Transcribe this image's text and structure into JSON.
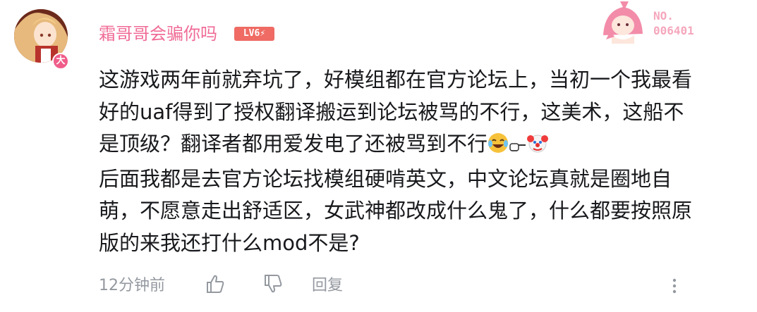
{
  "user": {
    "name": "霜哥哥会骗你吗",
    "level": "LV6",
    "avatar_badge": "大"
  },
  "decoration": {
    "number_label": "NO.",
    "number_value": "006401"
  },
  "comment": {
    "text": "这游戏两年前就弃坑了，好模组都在官方论坛上，当初一个我最看\n好的uaf得到了授权翻译搬运到论坛被骂的不行，这美术，这船不\n是顶级？翻译者都用爱发电了还被骂到不行",
    "text2": "后面我都是去官方论坛找模组硬啃英文，中文论坛真就是圈地自\n萌，不愿意走出舒适区，女武神都改成什么鬼了，什么都要按照原\n版的来我还打什么mod不是?"
  },
  "footer": {
    "time": "12分钟前",
    "reply_label": "回复"
  },
  "colors": {
    "username": "#f06b96",
    "level_badge": "#ef6b64",
    "text": "#18191c",
    "meta": "#9499a0"
  }
}
